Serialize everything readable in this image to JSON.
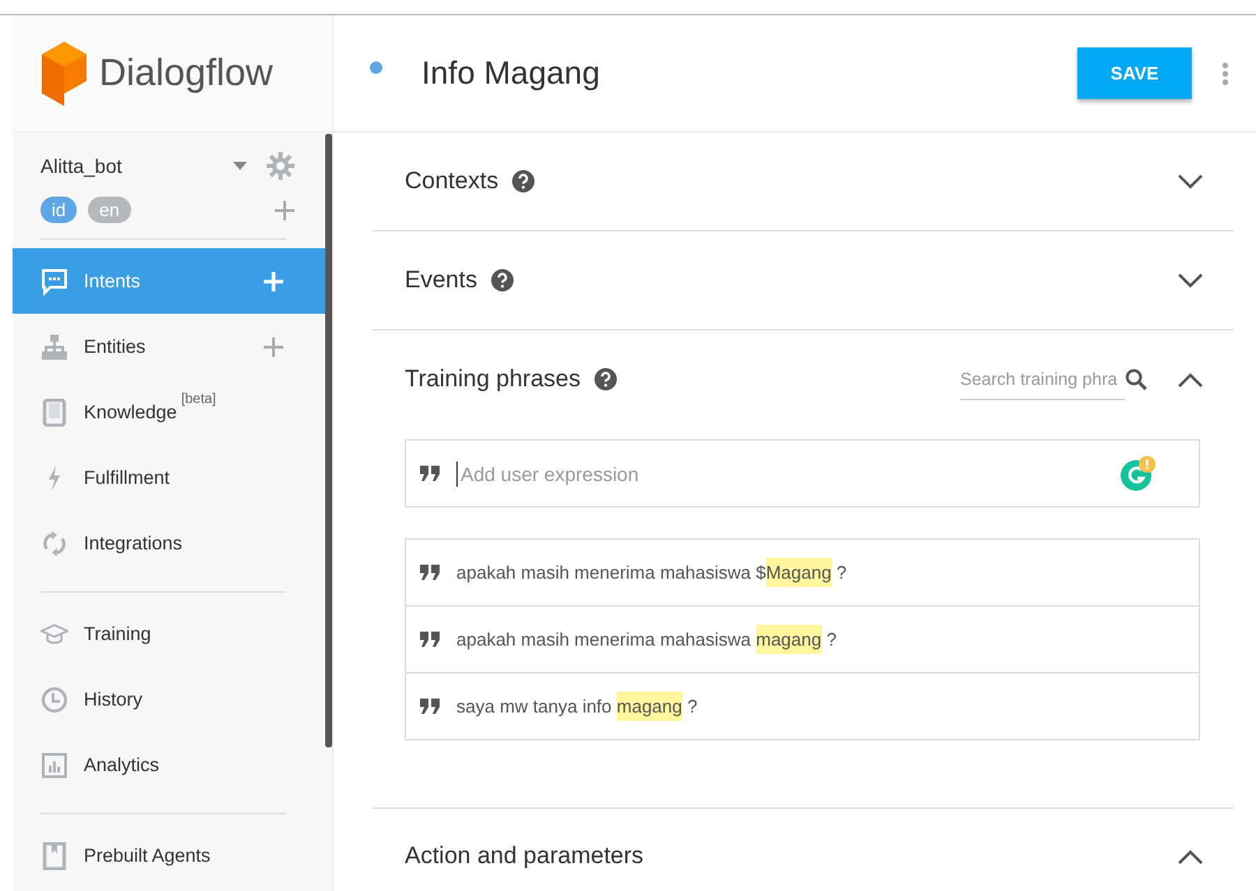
{
  "brand": {
    "name": "Dialogflow"
  },
  "agent": {
    "name": "Alitta_bot",
    "languages": [
      {
        "code": "id",
        "selected": true
      },
      {
        "code": "en",
        "selected": false
      }
    ]
  },
  "sidebar": {
    "sections": [
      [
        {
          "label": "Intents",
          "selected": true,
          "addable": true
        },
        {
          "label": "Entities",
          "selected": false,
          "addable": true
        },
        {
          "label": "Knowledge",
          "badge": "[beta]",
          "selected": false,
          "addable": false
        },
        {
          "label": "Fulfillment",
          "selected": false,
          "addable": false
        },
        {
          "label": "Integrations",
          "selected": false,
          "addable": false
        }
      ],
      [
        {
          "label": "Training",
          "selected": false,
          "addable": false
        },
        {
          "label": "History",
          "selected": false,
          "addable": false
        },
        {
          "label": "Analytics",
          "selected": false,
          "addable": false
        }
      ],
      [
        {
          "label": "Prebuilt Agents",
          "selected": false,
          "addable": false
        }
      ]
    ]
  },
  "intent": {
    "title": "Info Magang",
    "save_label": "SAVE"
  },
  "sections": [
    {
      "title": "Contexts",
      "help": true,
      "expanded": false
    },
    {
      "title": "Events",
      "help": true,
      "expanded": false
    },
    {
      "title": "Training phrases",
      "help": true,
      "expanded": true,
      "search_placeholder": "Search training phra",
      "input_placeholder": "Add user expression",
      "phrases": [
        {
          "parts": [
            {
              "text": "apakah masih menerima mahasiswa $",
              "highlight": false
            },
            {
              "text": "Magang",
              "highlight": true
            },
            {
              "text": " ?",
              "highlight": false
            }
          ]
        },
        {
          "parts": [
            {
              "text": "apakah masih menerima mahasiswa ",
              "highlight": false
            },
            {
              "text": "magang",
              "highlight": true
            },
            {
              "text": " ?",
              "highlight": false
            }
          ]
        },
        {
          "parts": [
            {
              "text": "saya mw tanya info ",
              "highlight": false
            },
            {
              "text": "magang",
              "highlight": true
            },
            {
              "text": " ?",
              "highlight": false
            }
          ]
        }
      ]
    },
    {
      "title": "Action and parameters",
      "help": false,
      "expanded": true
    }
  ]
}
